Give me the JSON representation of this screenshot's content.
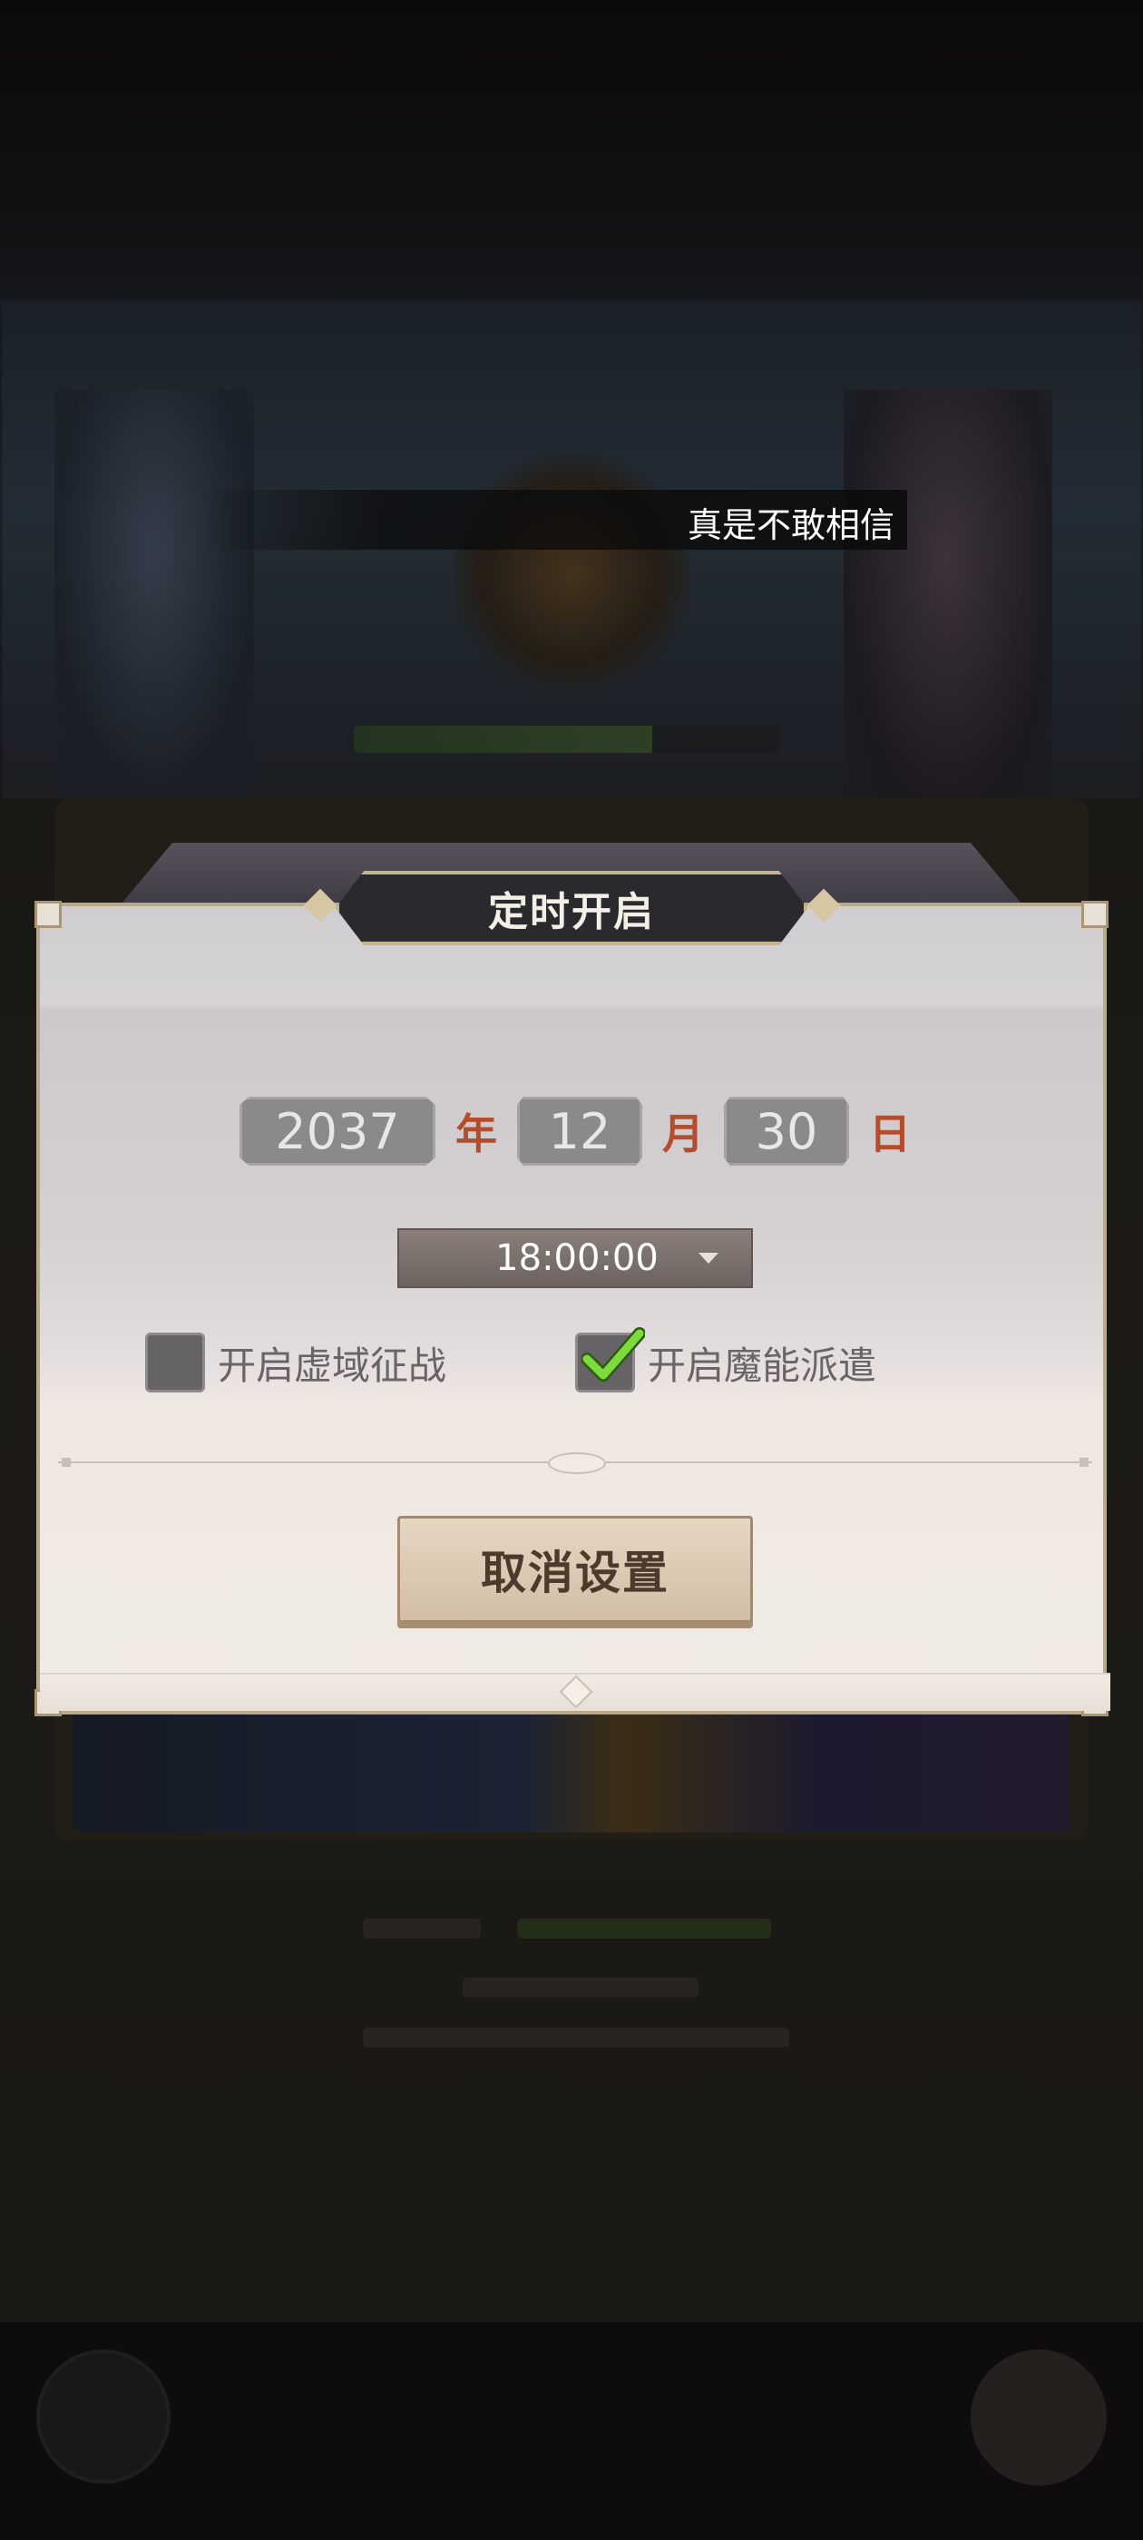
{
  "caption": {
    "text": "真是不敢相信"
  },
  "dialog": {
    "title": "定时开启",
    "date": {
      "year": "2037",
      "year_unit": "年",
      "month": "12",
      "month_unit": "月",
      "day": "30",
      "day_unit": "日"
    },
    "time": {
      "value": "18:00:00"
    },
    "options": [
      {
        "label": "开启虚域征战",
        "checked": false
      },
      {
        "label": "开启魔能派遣",
        "checked": true
      }
    ],
    "cancel_button": "取消设置"
  },
  "colors": {
    "accent_red": "#b44d2c",
    "check_green": "#7bdc3c",
    "button_text": "#4c3a2c"
  },
  "icons": [
    "checkmark-icon",
    "dropdown-caret-icon"
  ]
}
